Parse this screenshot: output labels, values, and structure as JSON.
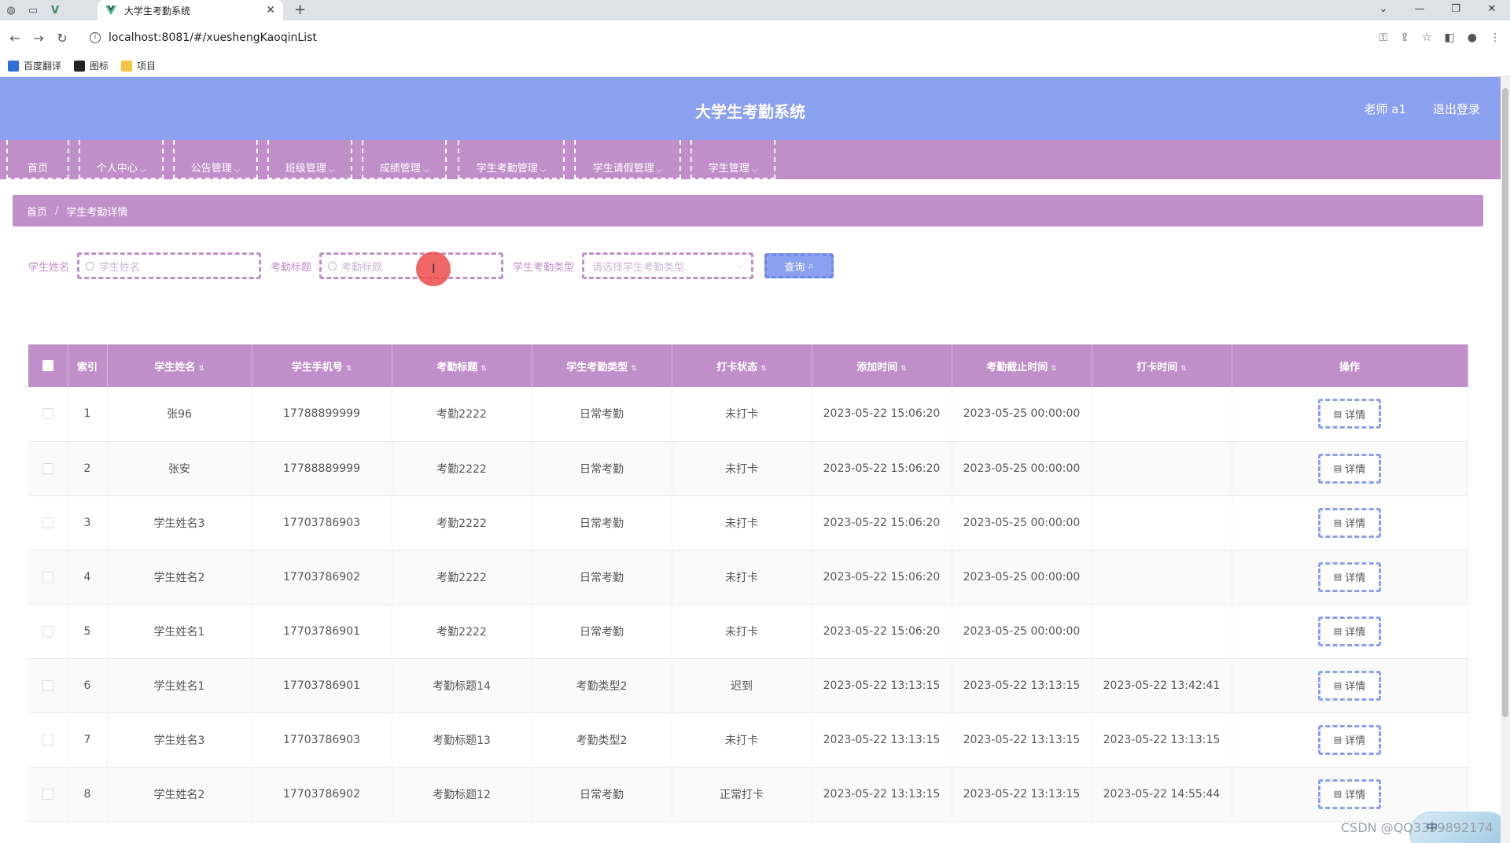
{
  "browser": {
    "tab_title": "大学生考勤系统",
    "url": "localhost:8081/#/xueshengKaoqinList",
    "bookmarks": [
      "百度翻译",
      "图标",
      "项目"
    ]
  },
  "header": {
    "title": "大学生考勤系统",
    "user": "老师 a1",
    "logout": "退出登录"
  },
  "menu": [
    "首页",
    "个人中心",
    "公告管理",
    "班级管理",
    "成绩管理",
    "学生考勤管理",
    "学生请假管理",
    "学生管理"
  ],
  "breadcrumb": {
    "home": "首页",
    "current": "学生考勤详情"
  },
  "search": {
    "name_label": "学生姓名",
    "name_placeholder": "学生姓名",
    "title_label": "考勤标题",
    "title_placeholder": "考勤标题",
    "type_label": "学生考勤类型",
    "type_placeholder": "请选择学生考勤类型",
    "query_button": "查询"
  },
  "table": {
    "columns": [
      "索引",
      "学生姓名",
      "学生手机号",
      "考勤标题",
      "学生考勤类型",
      "打卡状态",
      "添加时间",
      "考勤截止时间",
      "打卡时间",
      "操作"
    ],
    "detail_label": "详情",
    "rows": [
      [
        "1",
        "张96",
        "17788899999",
        "考勤2222",
        "日常考勤",
        "未打卡",
        "2023-05-22 15:06:20",
        "2023-05-25 00:00:00",
        ""
      ],
      [
        "2",
        "张安",
        "17788889999",
        "考勤2222",
        "日常考勤",
        "未打卡",
        "2023-05-22 15:06:20",
        "2023-05-25 00:00:00",
        ""
      ],
      [
        "3",
        "学生姓名3",
        "17703786903",
        "考勤2222",
        "日常考勤",
        "未打卡",
        "2023-05-22 15:06:20",
        "2023-05-25 00:00:00",
        ""
      ],
      [
        "4",
        "学生姓名2",
        "17703786902",
        "考勤2222",
        "日常考勤",
        "未打卡",
        "2023-05-22 15:06:20",
        "2023-05-25 00:00:00",
        ""
      ],
      [
        "5",
        "学生姓名1",
        "17703786901",
        "考勤2222",
        "日常考勤",
        "未打卡",
        "2023-05-22 15:06:20",
        "2023-05-25 00:00:00",
        ""
      ],
      [
        "6",
        "学生姓名1",
        "17703786901",
        "考勤标题14",
        "考勤类型2",
        "迟到",
        "2023-05-22 13:13:15",
        "2023-05-22 13:13:15",
        "2023-05-22 13:42:41"
      ],
      [
        "7",
        "学生姓名3",
        "17703786903",
        "考勤标题13",
        "考勤类型2",
        "未打卡",
        "2023-05-22 13:13:15",
        "2023-05-22 13:13:15",
        "2023-05-22 13:13:15"
      ],
      [
        "8",
        "学生姓名2",
        "17703786902",
        "考勤标题12",
        "日常考勤",
        "正常打卡",
        "2023-05-22 13:13:15",
        "2023-05-22 13:13:15",
        "2023-05-22 14:55:44"
      ]
    ]
  },
  "float_widget": "中",
  "watermark": "CSDN @QQ3359892174",
  "colors": {
    "header": "#8ba0ef",
    "menu": "#c08fca",
    "accent": "#c08fca"
  }
}
